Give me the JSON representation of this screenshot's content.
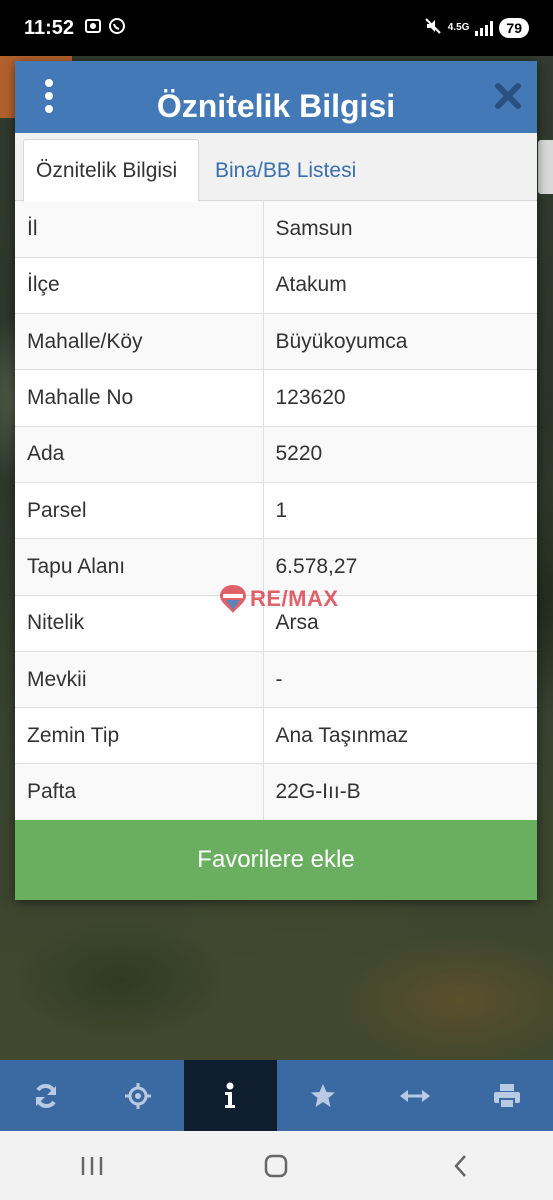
{
  "status_bar": {
    "time": "11:52",
    "network": "4.5G",
    "battery": "79"
  },
  "dialog": {
    "title": "Öznitelik Bilgisi",
    "tabs": [
      {
        "label": "Öznitelik Bilgisi",
        "active": true
      },
      {
        "label": "Bina/BB Listesi",
        "active": false
      }
    ],
    "rows": [
      {
        "key": "İl",
        "value": "Samsun"
      },
      {
        "key": "İlçe",
        "value": "Atakum"
      },
      {
        "key": "Mahalle/Köy",
        "value": "Büyükoyumca"
      },
      {
        "key": "Mahalle No",
        "value": "123620"
      },
      {
        "key": "Ada",
        "value": "5220"
      },
      {
        "key": "Parsel",
        "value": "1"
      },
      {
        "key": "Tapu Alanı",
        "value": "6.578,27"
      },
      {
        "key": "Nitelik",
        "value": "Arsa"
      },
      {
        "key": "Mevkii",
        "value": "-"
      },
      {
        "key": "Zemin Tip",
        "value": "Ana Taşınmaz"
      },
      {
        "key": "Pafta",
        "value": "22G-Iıı-B"
      }
    ],
    "favorite_button": "Favorilere ekle"
  },
  "watermark": {
    "text": "RE/MAX"
  },
  "toolbar": {
    "tools": [
      "refresh-icon",
      "locate-icon",
      "info-icon",
      "star-icon",
      "measure-icon",
      "print-icon"
    ],
    "active_index": 2
  },
  "colors": {
    "header": "#4479b8",
    "favorite": "#6aae60",
    "toolbar": "#3b6aa2",
    "toolbar_active": "#0f1e2f",
    "tab_link": "#3a6fb0"
  }
}
